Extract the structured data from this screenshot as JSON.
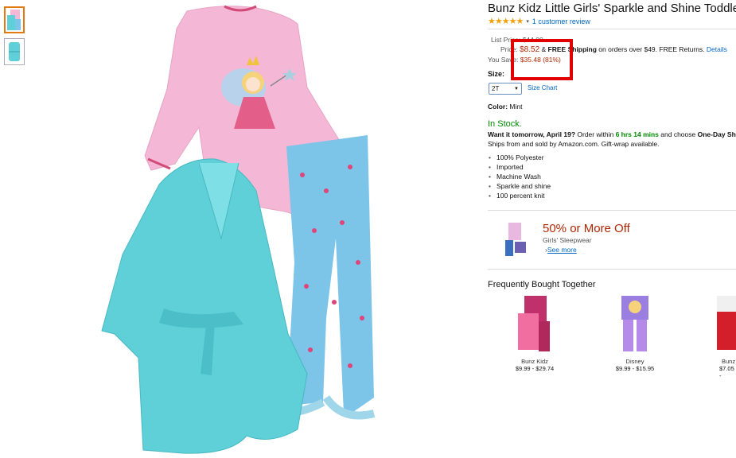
{
  "product": {
    "title": "Bunz Kidz Little Girls' Sparkle and Shine Toddler",
    "rating_stars": "★★★★★",
    "review_link": "1 customer review"
  },
  "pricing": {
    "list_price_label": "List Price:",
    "list_price": "$44.00",
    "price_label": "Price:",
    "price": "$8.52",
    "shipping_prefix": "& ",
    "free_shipping": "FREE Shipping",
    "shipping_suffix": " on orders over $49. FREE Returns.",
    "details_link": "Details",
    "save_label": "You Save:",
    "save_amount": "$35.48 (81%)"
  },
  "size": {
    "label": "Size:",
    "selected": "2T",
    "chart_link": "Size Chart"
  },
  "color": {
    "label": "Color:",
    "value": "Mint"
  },
  "availability": {
    "stock": "In Stock.",
    "want_it": "Want it tomorrow, April 19?",
    "order_within": " Order within ",
    "countdown": "6 hrs 14 mins",
    "choose": " and choose ",
    "one_day": "One-Day Shi",
    "ships_from": "Ships from and sold by Amazon.com. Gift-wrap available."
  },
  "features": [
    "100% Polyester",
    "Imported",
    "Machine Wash",
    "Sparkle and shine",
    "100 percent knit"
  ],
  "promo": {
    "title": "50% or More Off",
    "subtitle": "Girls' Sleepwear",
    "link": "See more",
    "arrow": "›"
  },
  "fbt": {
    "title": "Frequently Bought Together",
    "items": [
      {
        "brand": "Bunz Kidz",
        "price": "$9.99 - $29.74"
      },
      {
        "brand": "Disney",
        "price": "$9.99 - $15.95"
      },
      {
        "brand": "Bunz",
        "price": "$7.05 -"
      }
    ]
  },
  "colors": {
    "price_red": "#b12704",
    "link_blue": "#0066c0",
    "stock_green": "#008a00",
    "highlight_red": "#e00000",
    "robe_aqua": "#5fd0d8",
    "top_pink": "#f4b8d6"
  }
}
